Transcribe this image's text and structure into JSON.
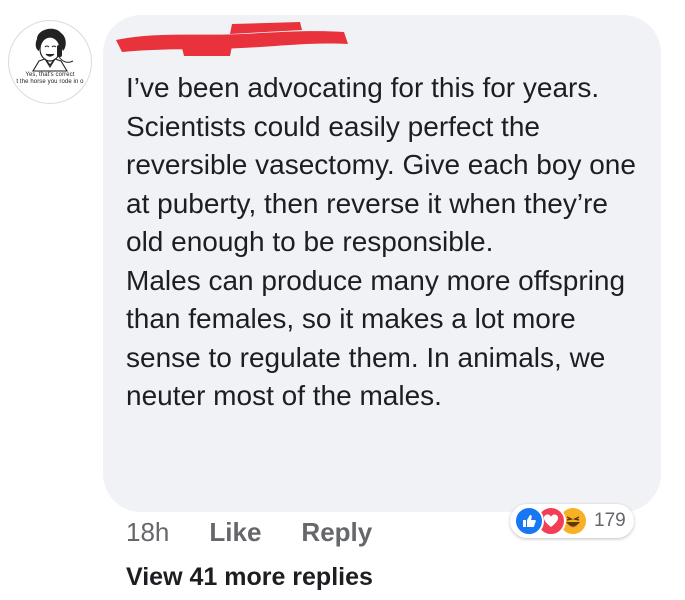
{
  "avatar": {
    "caption_line1": "Yes, that's correct",
    "caption_line2": "t the horse you rode in o"
  },
  "comment": {
    "author": "",
    "paragraphs": [
      "I’ve been advocating for this for years. Scientists could easily perfect the reversible vasectomy. Give each boy one at puberty, then reverse it when they’re old enough to be responsible.",
      "Males can produce many more offspring than females, so it makes a lot more sense to regulate them. In animals, we neuter most of the males."
    ]
  },
  "reactions": {
    "icons": [
      "like-icon",
      "love-icon",
      "haha-icon"
    ],
    "count": "179",
    "colors": {
      "like": "#1877f2",
      "love": "#f33e58",
      "haha": "#f7b125"
    }
  },
  "actions": {
    "time": "18h",
    "like_label": "Like",
    "reply_label": "Reply"
  },
  "more_replies_label": "View 41 more replies",
  "colors": {
    "bubble": "#f0f2f5",
    "secondary_text": "#65676b",
    "redaction": "#e8323c"
  }
}
